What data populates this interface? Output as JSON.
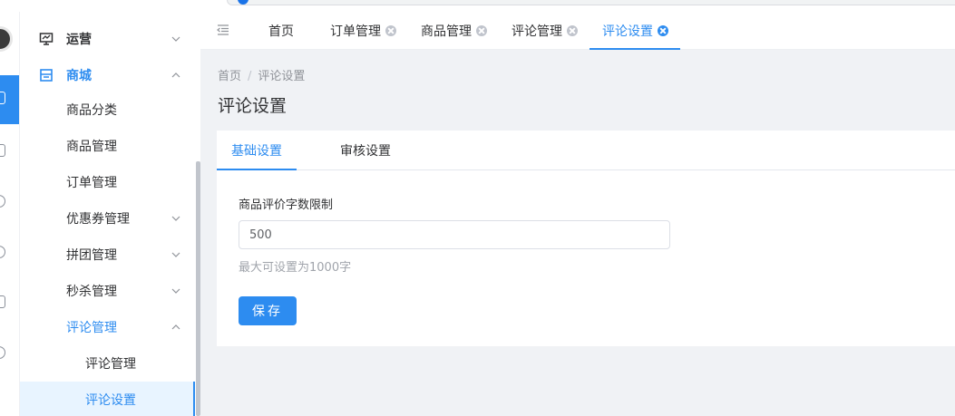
{
  "icons": {
    "rail": [
      "user-avatar",
      "grid-icon",
      "dashboard-icon",
      "globe-icon",
      "link-icon",
      "document-icon",
      "link-icon"
    ],
    "menu_operations": "monitor-icon",
    "menu_mall": "storefront-icon",
    "collapse": "collapse-menu-icon",
    "chevron": "chevron-icon",
    "tab_close": "close-circle-icon"
  },
  "colors": {
    "primary": "#2d8cf0",
    "selected_bg": "#e8f4ff",
    "text": "#303133",
    "muted": "#909399"
  },
  "sidebar": {
    "items": [
      {
        "label": "运营",
        "level": 0,
        "expanded": false
      },
      {
        "label": "商城",
        "level": 0,
        "expanded": true
      },
      {
        "label": "商品分类",
        "level": 1
      },
      {
        "label": "商品管理",
        "level": 1
      },
      {
        "label": "订单管理",
        "level": 1
      },
      {
        "label": "优惠券管理",
        "level": 1,
        "expanded": false
      },
      {
        "label": "拼团管理",
        "level": 1,
        "expanded": false
      },
      {
        "label": "秒杀管理",
        "level": 1,
        "expanded": false
      },
      {
        "label": "评论管理",
        "level": 1,
        "expanded": true
      },
      {
        "label": "评论管理",
        "level": 2
      },
      {
        "label": "评论设置",
        "level": 2,
        "selected": true
      }
    ]
  },
  "tabs": [
    {
      "label": "首页",
      "closable": false
    },
    {
      "label": "订单管理",
      "closable": true
    },
    {
      "label": "商品管理",
      "closable": true
    },
    {
      "label": "评论管理",
      "closable": true
    },
    {
      "label": "评论设置",
      "closable": true,
      "active": true
    }
  ],
  "breadcrumb": {
    "home": "首页",
    "separator": "/",
    "current": "评论设置"
  },
  "page": {
    "title": "评论设置"
  },
  "subtabs": [
    {
      "label": "基础设置",
      "active": true
    },
    {
      "label": "审核设置",
      "active": false
    }
  ],
  "form": {
    "label": "商品评价字数限制",
    "value": "500",
    "help": "最大可设置为1000字",
    "save_label": "保存"
  }
}
